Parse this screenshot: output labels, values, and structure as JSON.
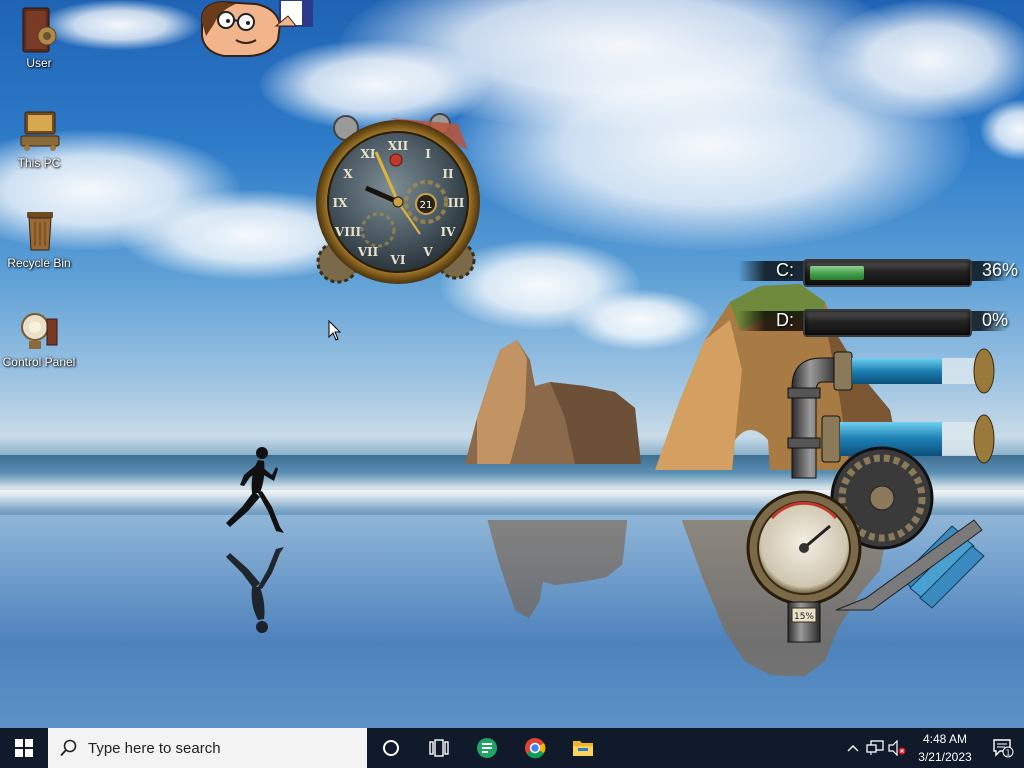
{
  "desktop": {
    "icons": [
      {
        "label": "User"
      },
      {
        "label": "This PC"
      },
      {
        "label": "Recycle Bin"
      },
      {
        "label": "Control Panel"
      }
    ]
  },
  "clock_widget": {
    "date_dial": "21"
  },
  "drive_widget": {
    "drives": [
      {
        "letter": "C:",
        "percent_text": "36%",
        "percent": 36
      },
      {
        "letter": "D:",
        "percent_text": "0%",
        "percent": 0
      }
    ]
  },
  "cpu_widget": {
    "gauge_text": "15%",
    "percent": 15
  },
  "taskbar": {
    "search_placeholder": "Type here to search",
    "apps": [
      "cortana-icon",
      "task-view-icon",
      "sheets-icon",
      "chrome-icon",
      "file-explorer-icon"
    ],
    "time": "4:48 AM",
    "date": "3/21/2023",
    "notification_count": "1"
  },
  "colors": {
    "taskbar": "#101a2a",
    "drive_fill": "#3f9a44",
    "search_bg": "#f3f3f3"
  }
}
